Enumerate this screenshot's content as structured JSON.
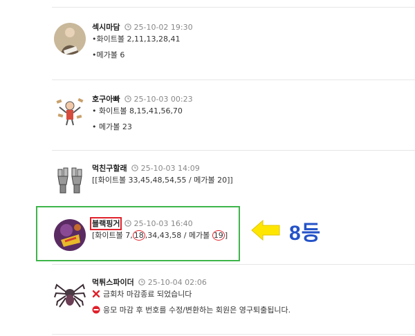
{
  "comments": [
    {
      "nick": "섹시마담",
      "time": "25-10-02 19:30",
      "lines": [
        "•화이트볼 2,11,13,28,41",
        "•메가볼 6"
      ]
    },
    {
      "nick": "호구아빠",
      "time": "25-10-03 00:23",
      "lines": [
        "• 화이트볼 8,15,41,56,70",
        "• 메가볼 23"
      ]
    },
    {
      "nick": "먹친구할래",
      "time": "25-10-03 14:09",
      "lines": [
        "[[화이트볼 33,45,48,54,55 / 메가볼 20]]"
      ]
    },
    {
      "nick": "블랙핑거",
      "time": "25-10-03 16:40",
      "line_pre": "[화이트볼 7,",
      "line_circ1": "18",
      "line_mid": ",34,43,58 / 메가볼 ",
      "line_circ2": "19",
      "line_post": "]"
    },
    {
      "nick": "먹튀스파이더",
      "time": "25-10-04 02:06",
      "lines": [
        "금회차 마감종료 되었습니다",
        "응모 마감 후 번호를 수정/변환하는 회원은 영구퇴출됩니다."
      ]
    }
  ],
  "annotation": {
    "rank_label": "8등"
  },
  "icons": {
    "clock": "clock-icon",
    "closed": "x-mark-icon",
    "warning": "no-entry-icon",
    "arrow": "arrow-left-icon"
  },
  "colors": {
    "highlight_border": "#3db54a",
    "nick_box": "#e0202a",
    "rank_text": "#2453c8",
    "arrow_fill": "#ffe600"
  }
}
